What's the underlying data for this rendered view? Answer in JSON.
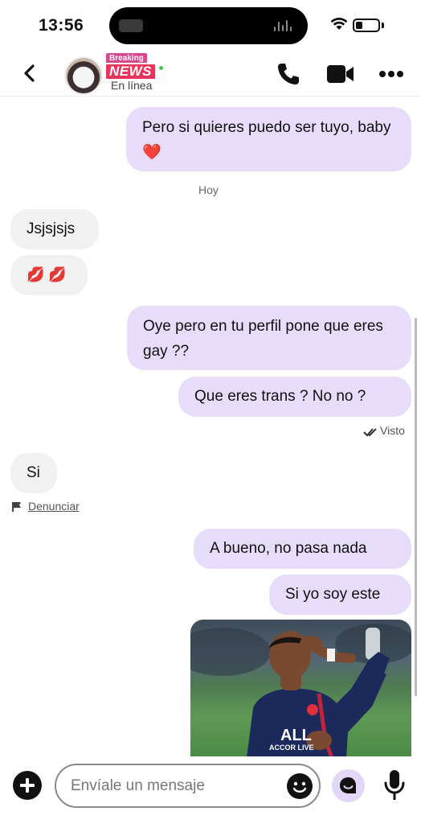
{
  "status_bar": {
    "time": "13:56"
  },
  "header": {
    "badge_top": "Breaking",
    "badge_main": "NEWS",
    "status": "En línea"
  },
  "messages": [
    {
      "dir": "out",
      "text": "Pero si quieres puedo ser tuyo, baby❤️"
    },
    {
      "dir": "day",
      "text": "Hoy"
    },
    {
      "dir": "in",
      "text": "Jsjsjsjs"
    },
    {
      "dir": "in",
      "text": "💋 💋"
    },
    {
      "dir": "out",
      "text": "Oye pero en tu perfil pone que eres gay ??"
    },
    {
      "dir": "out",
      "text": "Que eres trans ? No no ?"
    },
    {
      "dir": "in",
      "text": "Si"
    },
    {
      "dir": "out",
      "text": "A bueno, no pasa nada"
    },
    {
      "dir": "out",
      "text": "Si yo soy este"
    }
  ],
  "seen_label": "Visto",
  "report_label": "Denunciar",
  "photo": {
    "shirt_text": "ALL",
    "sponsor_text": "ACCOR LIVE"
  },
  "input": {
    "placeholder": "Envíale un mensaje"
  },
  "colors": {
    "outgoing_bubble": "#e7dcf9",
    "incoming_bubble": "#f1f1f1",
    "accent": "#e3d6f6"
  },
  "icons": [
    "back-arrow-icon",
    "phone-icon",
    "video-camera-icon",
    "more-dots-icon",
    "double-check-icon",
    "flag-icon",
    "plus-icon",
    "smiley-icon",
    "chat-bubble-icon",
    "microphone-icon"
  ]
}
